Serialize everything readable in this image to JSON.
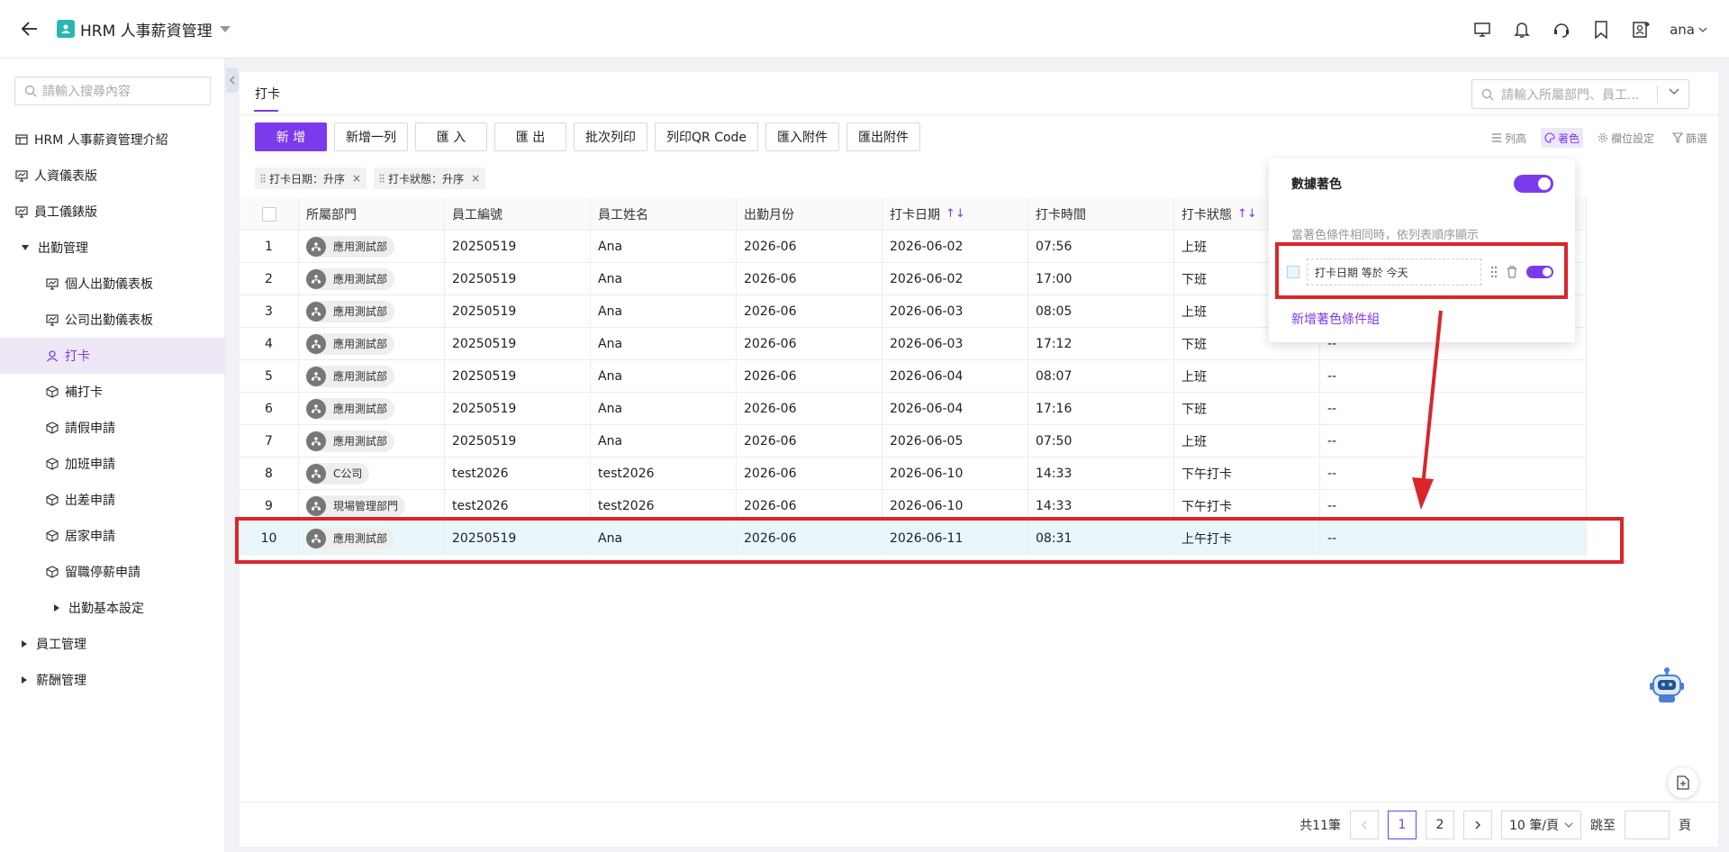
{
  "header": {
    "app_title": "HRM 人事薪資管理",
    "user": "ana"
  },
  "sidebar": {
    "search_placeholder": "請輸入搜尋內容",
    "items": [
      {
        "label": "HRM 人事薪資管理介紹",
        "level": 0,
        "icon": "table-icon"
      },
      {
        "label": "人資儀表版",
        "level": 0,
        "icon": "dashboard-icon"
      },
      {
        "label": "員工儀錶版",
        "level": 0,
        "icon": "dashboard-icon"
      },
      {
        "label": "出勤管理",
        "level": 1,
        "expand": "down"
      },
      {
        "label": "個人出勤儀表板",
        "level": 2,
        "icon": "dashboard-icon"
      },
      {
        "label": "公司出勤儀表板",
        "level": 2,
        "icon": "dashboard-icon"
      },
      {
        "label": "打卡",
        "level": 2,
        "icon": "user-icon",
        "active": true
      },
      {
        "label": "補打卡",
        "level": 2,
        "icon": "cube-icon"
      },
      {
        "label": "請假申請",
        "level": 2,
        "icon": "cube-icon"
      },
      {
        "label": "加班申請",
        "level": 2,
        "icon": "cube-icon"
      },
      {
        "label": "出差申請",
        "level": 2,
        "icon": "cube-icon"
      },
      {
        "label": "居家申請",
        "level": 2,
        "icon": "cube-icon"
      },
      {
        "label": "留職停薪申請",
        "level": 2,
        "icon": "cube-icon"
      },
      {
        "label": "出勤基本設定",
        "level": 3,
        "expand": "right"
      },
      {
        "label": "員工管理",
        "level": 1,
        "expand": "right"
      },
      {
        "label": "薪酬管理",
        "level": 1,
        "expand": "right"
      }
    ]
  },
  "main": {
    "tab": "打卡",
    "search_placeholder": "請輸入所屬部門、員工...",
    "toolbar": [
      "新 增",
      "新增一列",
      "匯 入",
      "匯 出",
      "批次列印",
      "列印QR Code",
      "匯入附件",
      "匯出附件"
    ],
    "right_tools": [
      {
        "label": "列高",
        "icon": "row-height-icon",
        "active": false
      },
      {
        "label": "著色",
        "icon": "palette-icon",
        "active": true
      },
      {
        "label": "欄位設定",
        "icon": "gear-icon",
        "active": false
      },
      {
        "label": "篩選",
        "icon": "filter-icon",
        "active": false
      }
    ],
    "sort_tags": [
      "打卡日期：升序",
      "打卡狀態：升序"
    ],
    "columns": [
      "",
      "所屬部門",
      "員工編號",
      "員工姓名",
      "出勤月份",
      "打卡日期",
      "打卡時間",
      "打卡狀態",
      ""
    ],
    "rows": [
      {
        "no": "1",
        "dept": "應用測試部",
        "emp_id": "20250519",
        "name": "Ana",
        "month": "2026-06",
        "date": "2026-06-02",
        "time": "07:56",
        "status": "上班",
        "extra": "--"
      },
      {
        "no": "2",
        "dept": "應用測試部",
        "emp_id": "20250519",
        "name": "Ana",
        "month": "2026-06",
        "date": "2026-06-02",
        "time": "17:00",
        "status": "下班",
        "extra": "--"
      },
      {
        "no": "3",
        "dept": "應用測試部",
        "emp_id": "20250519",
        "name": "Ana",
        "month": "2026-06",
        "date": "2026-06-03",
        "time": "08:05",
        "status": "上班",
        "extra": "--"
      },
      {
        "no": "4",
        "dept": "應用測試部",
        "emp_id": "20250519",
        "name": "Ana",
        "month": "2026-06",
        "date": "2026-06-03",
        "time": "17:12",
        "status": "下班",
        "extra": "--"
      },
      {
        "no": "5",
        "dept": "應用測試部",
        "emp_id": "20250519",
        "name": "Ana",
        "month": "2026-06",
        "date": "2026-06-04",
        "time": "08:07",
        "status": "上班",
        "extra": "--"
      },
      {
        "no": "6",
        "dept": "應用測試部",
        "emp_id": "20250519",
        "name": "Ana",
        "month": "2026-06",
        "date": "2026-06-04",
        "time": "17:16",
        "status": "下班",
        "extra": "--"
      },
      {
        "no": "7",
        "dept": "應用測試部",
        "emp_id": "20250519",
        "name": "Ana",
        "month": "2026-06",
        "date": "2026-06-05",
        "time": "07:50",
        "status": "上班",
        "extra": "--"
      },
      {
        "no": "8",
        "dept": "C公司",
        "emp_id": "test2026",
        "name": "test2026",
        "month": "2026-06",
        "date": "2026-06-10",
        "time": "14:33",
        "status": "下午打卡",
        "extra": "--"
      },
      {
        "no": "9",
        "dept": "現場管理部門",
        "emp_id": "test2026",
        "name": "test2026",
        "month": "2026-06",
        "date": "2026-06-10",
        "time": "14:33",
        "status": "下午打卡",
        "extra": "--"
      },
      {
        "no": "10",
        "dept": "應用測試部",
        "emp_id": "20250519",
        "name": "Ana",
        "month": "2026-06",
        "date": "2026-06-11",
        "time": "08:31",
        "status": "上午打卡",
        "extra": "--",
        "highlight": true
      }
    ],
    "pager": {
      "total": "共11筆",
      "pages": [
        "1",
        "2"
      ],
      "current": "1",
      "page_size": "10 筆/頁",
      "goto_label": "跳至",
      "page_suffix": "頁"
    }
  },
  "color_popover": {
    "title": "數據著色",
    "enabled": true,
    "description": "當著色條件相同時，依列表順序顯示",
    "condition": "打卡日期 等於 今天",
    "add_link": "新增著色條件組"
  },
  "colors": {
    "accent": "#7c3aed",
    "highlight_row": "#e9f7fb",
    "annotation_red": "#d9262b"
  }
}
